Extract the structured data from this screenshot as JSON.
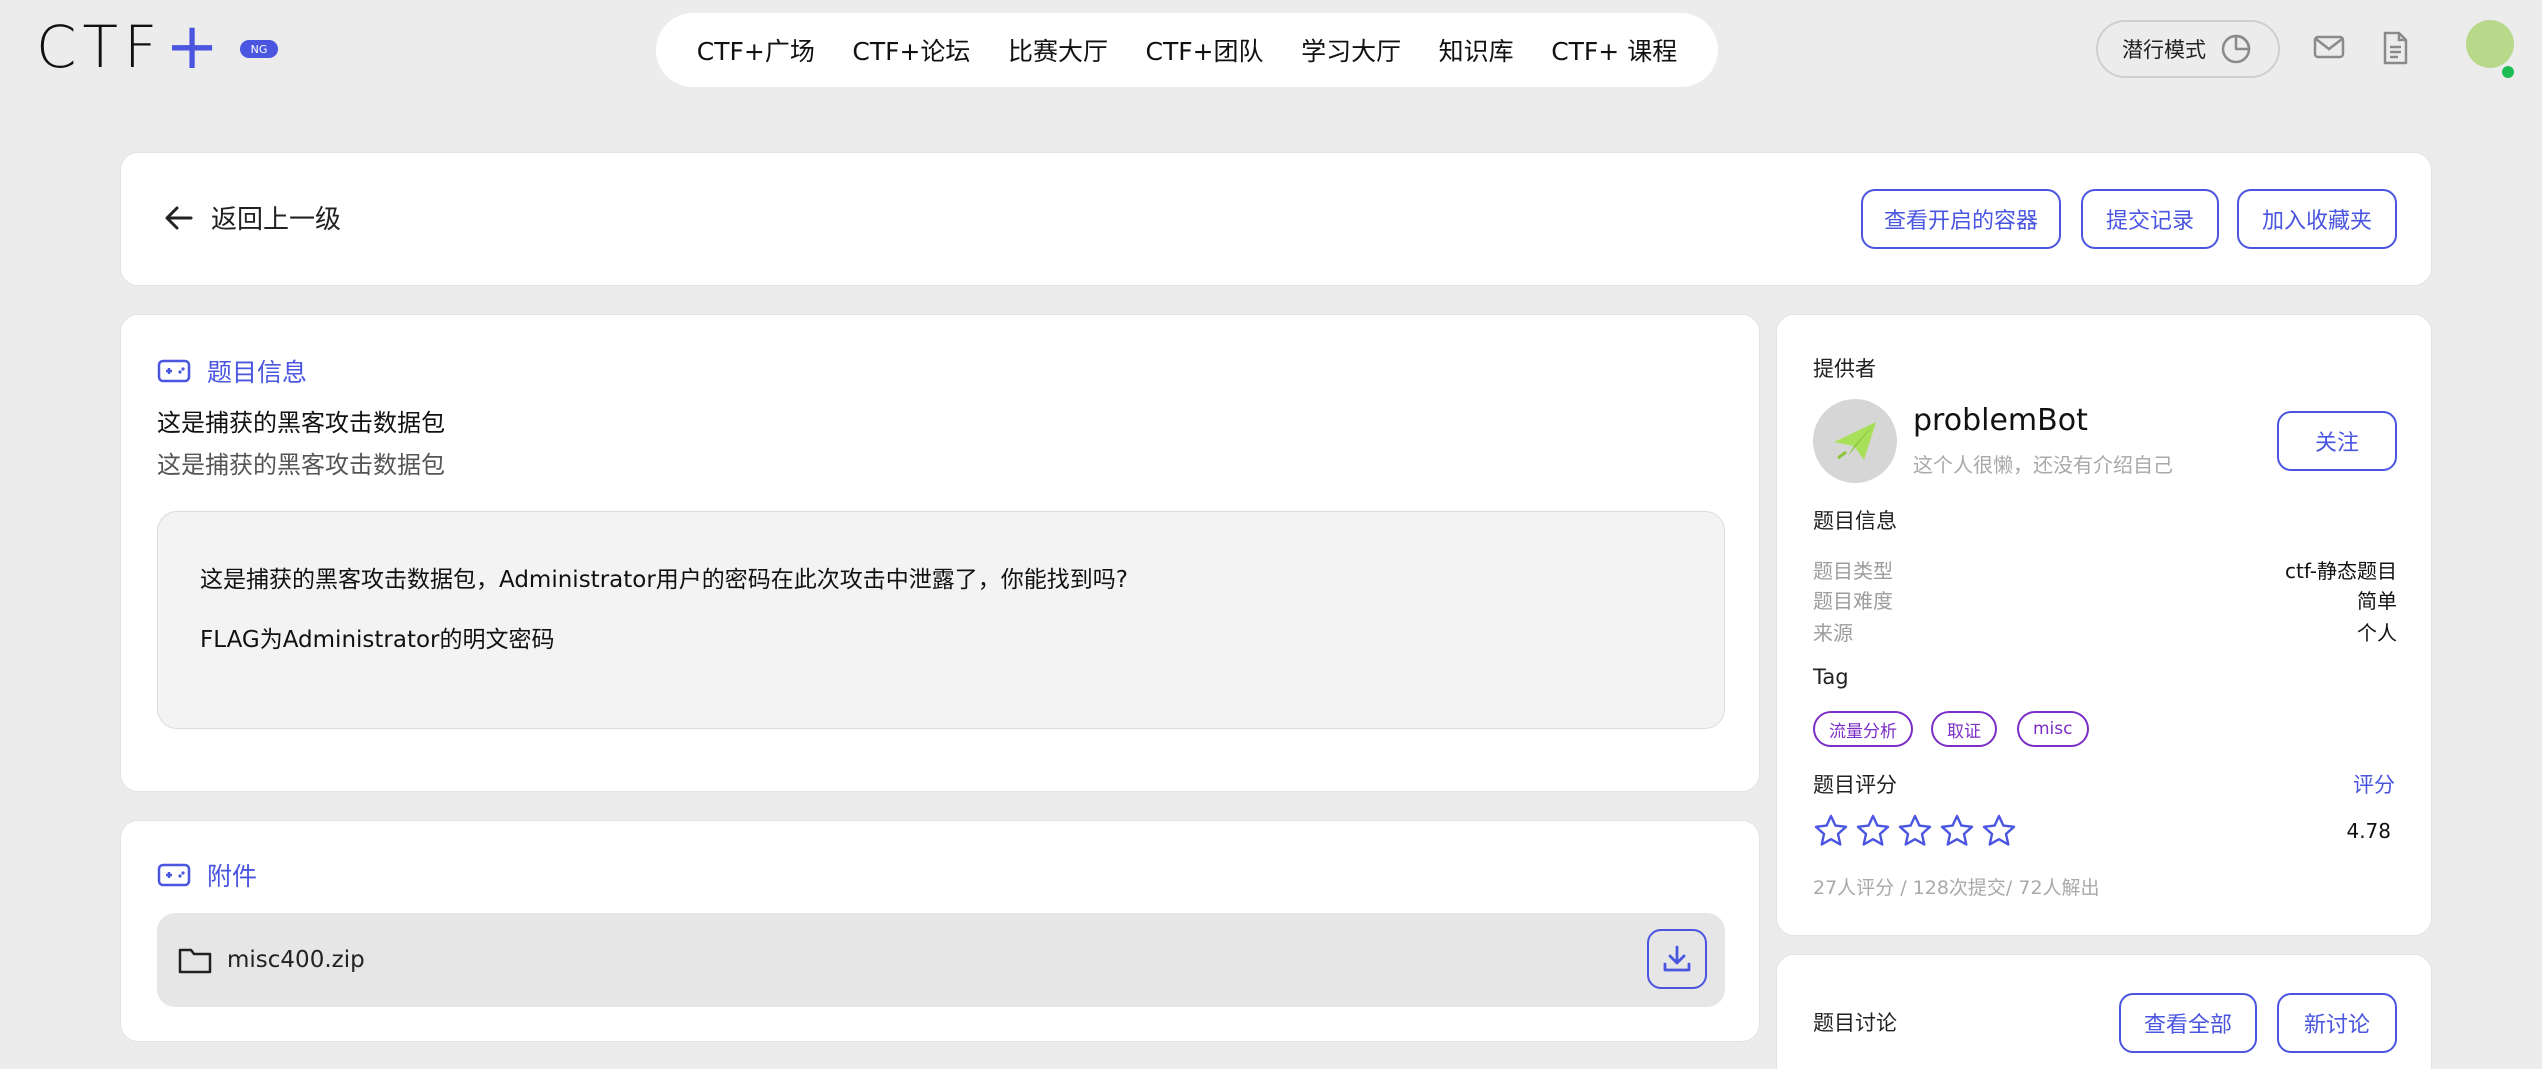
{
  "brand": {
    "logo_text": "CTF",
    "logo_plus": "+",
    "badge": "NG",
    "accent": "#4a55e0",
    "tag_color": "#7b2fc6"
  },
  "nav": {
    "items": [
      "CTF+广场",
      "CTF+论坛",
      "比赛大厅",
      "CTF+团队",
      "学习大厅",
      "知识库",
      "CTF+ 课程"
    ]
  },
  "header": {
    "stealth_label": "潜行模式"
  },
  "toolbar": {
    "back_label": "返回上一级",
    "containers_label": "查看开启的容器",
    "submissions_label": "提交记录",
    "favorite_label": "加入收藏夹"
  },
  "question": {
    "section_label": "题目信息",
    "title": "这是捕获的黑客攻击数据包",
    "subtitle": "这是捕获的黑客攻击数据包",
    "desc_line1": "这是捕获的黑客攻击数据包，Administrator用户的密码在此次攻击中泄露了，你能找到吗?",
    "desc_line2": "FLAG为Administrator的明文密码"
  },
  "attachment": {
    "section_label": "附件",
    "file_name": "misc400.zip"
  },
  "provider": {
    "label": "提供者",
    "name": "problemBot",
    "bio": "这个人很懒，还没有介绍自己",
    "follow_label": "关注"
  },
  "meta": {
    "section_label": "题目信息",
    "rows": [
      {
        "key": "题目类型",
        "value": "ctf-静态题目"
      },
      {
        "key": "题目难度",
        "value": "简单"
      },
      {
        "key": "来源",
        "value": "个人"
      }
    ],
    "tag_label": "Tag",
    "tags": [
      "流量分析",
      "取证",
      "misc"
    ]
  },
  "rating": {
    "label": "题目评分",
    "rate_link": "评分",
    "score": "4.78",
    "stars_filled": 0,
    "stars_total": 5,
    "stats": "27人评分 / 128次提交/ 72人解出"
  },
  "discussion": {
    "label": "题目讨论",
    "view_all_label": "查看全部",
    "new_label": "新讨论"
  }
}
